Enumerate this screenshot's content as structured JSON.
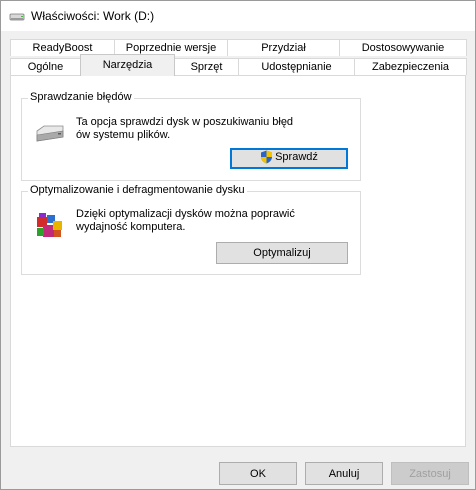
{
  "window": {
    "title": "Właściwości: Work (D:)",
    "icon": "drive-icon"
  },
  "tabs_row1": [
    "ReadyBoost",
    "Poprzednie wersje",
    "Przydział",
    "Dostosowywanie"
  ],
  "tabs_row2": [
    "Ogólne",
    "Narzędzia",
    "Sprzęt",
    "Udostępnianie",
    "Zabezpieczenia"
  ],
  "active_tab": "Narzędzia",
  "error_check": {
    "title": "Sprawdzanie błędów",
    "text_line1": "Ta opcja sprawdzi dysk w poszukiwaniu błęd",
    "text_line2": "ów systemu plików.",
    "button": "Sprawdź",
    "icon": "drive-icon",
    "button_icon": "uac-shield-icon"
  },
  "optimize": {
    "title": "Optymalizowanie i defragmentowanie dysku",
    "text_line1": "Dzięki optymalizacji dysków można poprawić",
    "text_line2": "wydajność komputera.",
    "button": "Optymalizuj",
    "icon": "defrag-icon"
  },
  "footer": {
    "ok": "OK",
    "cancel": "Anuluj",
    "apply": "Zastosuj"
  }
}
